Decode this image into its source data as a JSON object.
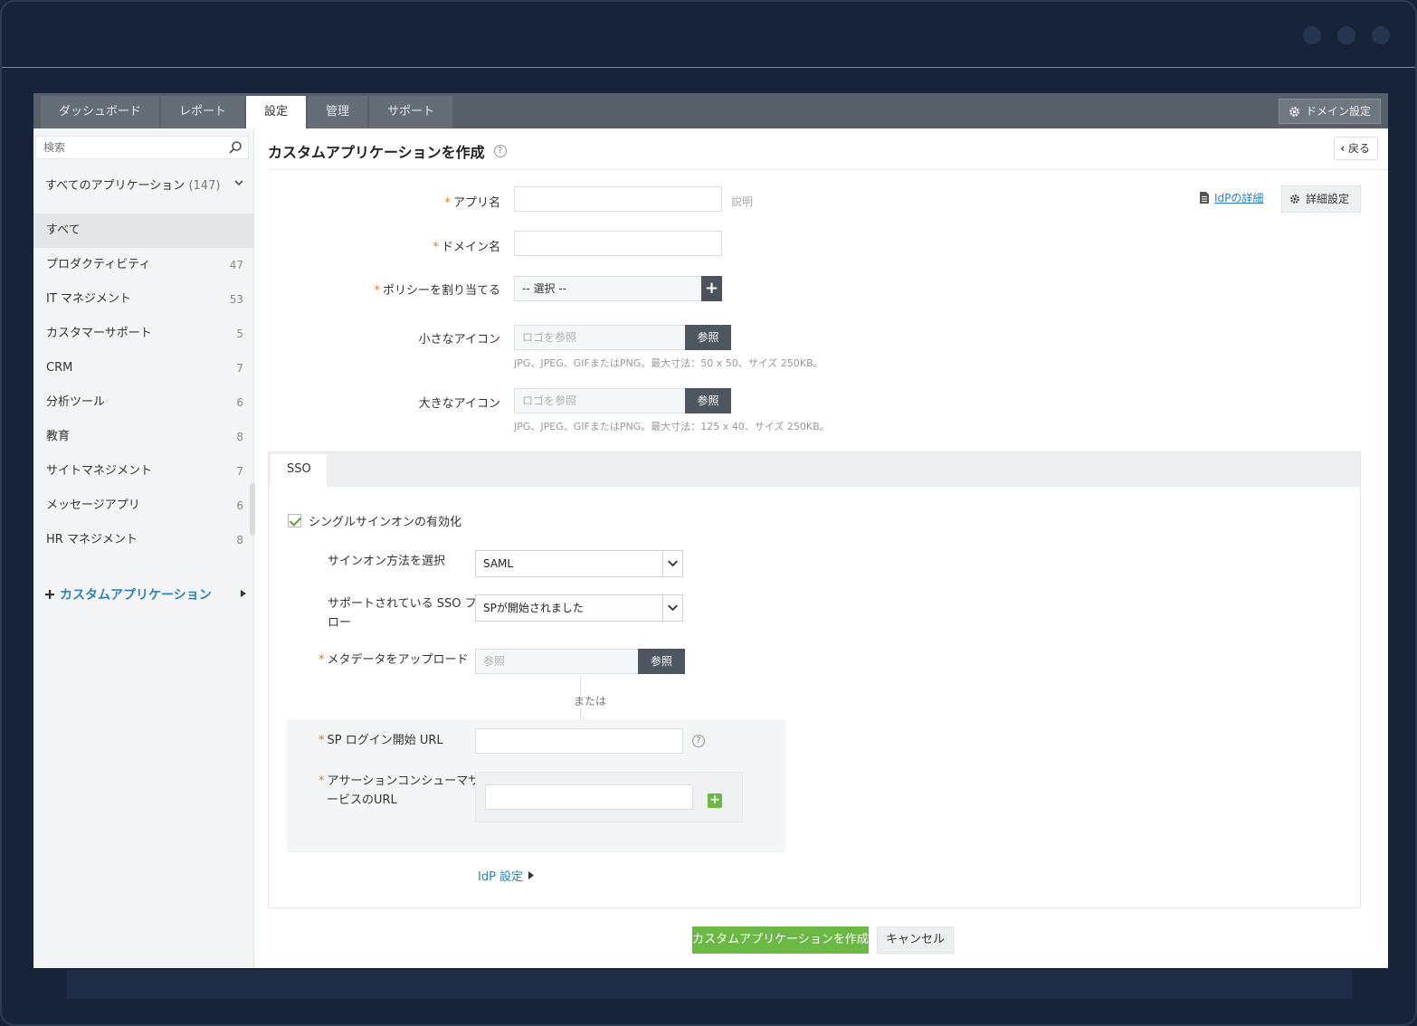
{
  "nav": {
    "tabs": [
      {
        "label": "ダッシュボード"
      },
      {
        "label": "レポート"
      },
      {
        "label": "設定"
      },
      {
        "label": "管理"
      },
      {
        "label": "サポート"
      }
    ],
    "domain_settings": "ドメイン設定"
  },
  "sidebar": {
    "search_placeholder": "検索",
    "all_apps_label": "すべてのアプリケーション",
    "all_apps_count": "(147)",
    "categories": [
      {
        "label": "すべて",
        "count": ""
      },
      {
        "label": "プロダクティビティ",
        "count": "47"
      },
      {
        "label": "IT マネジメント",
        "count": "53"
      },
      {
        "label": "カスタマーサポート",
        "count": "5"
      },
      {
        "label": "CRM",
        "count": "7"
      },
      {
        "label": "分析ツール",
        "count": "6"
      },
      {
        "label": "教育",
        "count": "8"
      },
      {
        "label": "サイトマネジメント",
        "count": "7"
      },
      {
        "label": "メッセージアプリ",
        "count": "6"
      },
      {
        "label": "HR マネジメント",
        "count": "8"
      }
    ],
    "custom_apps": "カスタムアプリケーション"
  },
  "page": {
    "title": "カスタムアプリケーションを作成",
    "back": "戻る",
    "idp_details": "IdPの詳細",
    "advanced_settings": "詳細設定"
  },
  "form": {
    "app_name_label": "アプリ名",
    "description_placeholder": "説明",
    "domain_label": "ドメイン名",
    "policy_label": "ポリシーを割り当てる",
    "policy_value": "-- 選択 --",
    "small_icon_label": "小さなアイコン",
    "small_icon_placeholder": "ロゴを参照",
    "browse": "参照",
    "small_icon_hint": "JPG、JPEG、GIFまたはPNG。最大寸法：50 x 50、サイズ 250KB。",
    "large_icon_label": "大きなアイコン",
    "large_icon_placeholder": "ロゴを参照",
    "large_icon_hint": "JPG、JPEG、GIFまたはPNG。最大寸法：125 x 40、サイズ 250KB。"
  },
  "sso": {
    "tab": "SSO",
    "enable_label": "シングルサインオンの有効化",
    "enabled": true,
    "method_label": "サインオン方法を選択",
    "method_value": "SAML",
    "flow_label_line1": "サポートされている SSO フ",
    "flow_label_line2": "ロー",
    "flow_value": "SPが開始されました",
    "metadata_label": "メタデータをアップロード",
    "metadata_placeholder": "参照",
    "metadata_browse": "参照",
    "or": "または",
    "sp_login_label": "SP ログイン開始 URL",
    "acs_label_line1": "アサーションコンシューマサ",
    "acs_label_line2": "ービスのURL",
    "idp_settings": "IdP 設定"
  },
  "actions": {
    "create": "カスタムアプリケーションを作成",
    "cancel": "キャンセル"
  },
  "colors": {
    "accent_green": "#6cb845",
    "link_blue": "#2b7fc4",
    "navbar": "#575f69",
    "required": "#e07b1a"
  }
}
